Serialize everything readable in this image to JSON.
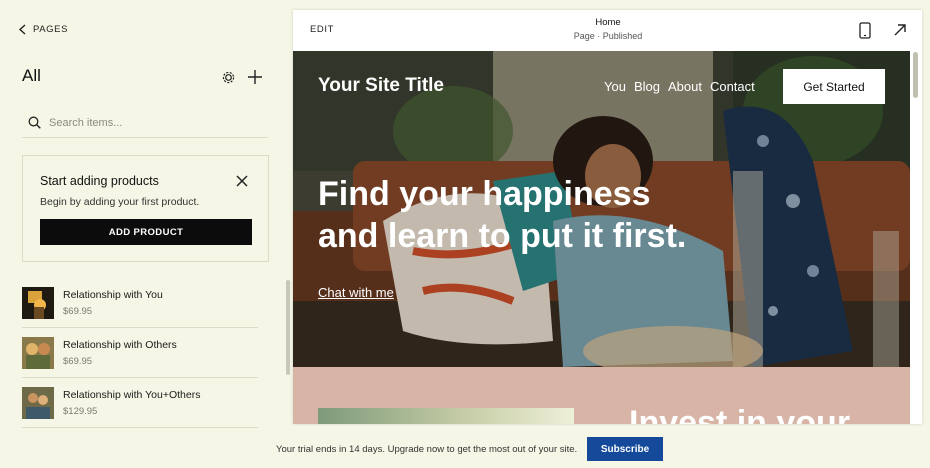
{
  "sidebar": {
    "back_label": "PAGES",
    "title": "All",
    "search": {
      "placeholder": "Search items..."
    },
    "promo": {
      "title": "Start adding products",
      "description": "Begin by adding your first product.",
      "button_label": "ADD PRODUCT"
    },
    "products": [
      {
        "name": "Relationship with You",
        "price": "$69.95"
      },
      {
        "name": "Relationship with Others",
        "price": "$69.95"
      },
      {
        "name": "Relationship with You+Others",
        "price": "$129.95"
      }
    ]
  },
  "preview_header": {
    "edit_label": "EDIT",
    "page_name": "Home",
    "page_status": "Page · Published"
  },
  "site": {
    "title": "Your Site Title",
    "nav": [
      "You",
      "Blog",
      "About",
      "Contact"
    ],
    "cta_label": "Get Started",
    "headline_line1": "Find your happiness",
    "headline_line2": "and learn to put it first.",
    "link_label": "Chat with me",
    "section2_heading": "Invest in your"
  },
  "footer": {
    "trial_text": "Your trial ends in 14 days. Upgrade now to get the most out of your site.",
    "subscribe_label": "Subscribe"
  },
  "colors": {
    "background": "#f5f6e6",
    "primary_button": "#0c0c0c",
    "subscribe": "#154a9b",
    "section2": "#d7b4a6"
  }
}
